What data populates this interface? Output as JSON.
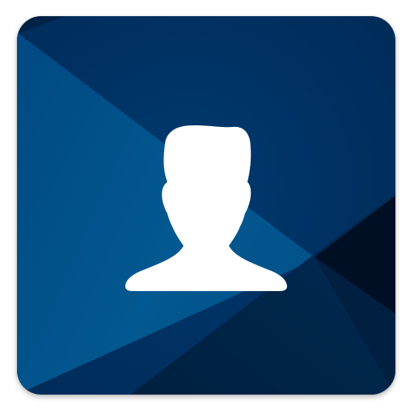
{
  "app_icon": {
    "title": "",
    "icon": "user-silhouette-icon",
    "colors": {
      "base": "#003162",
      "highlight": "#025a92",
      "dark": "#011a37",
      "darkest": "#000f24",
      "glyph": "#ffffff",
      "page_background": "#ffffff"
    }
  }
}
